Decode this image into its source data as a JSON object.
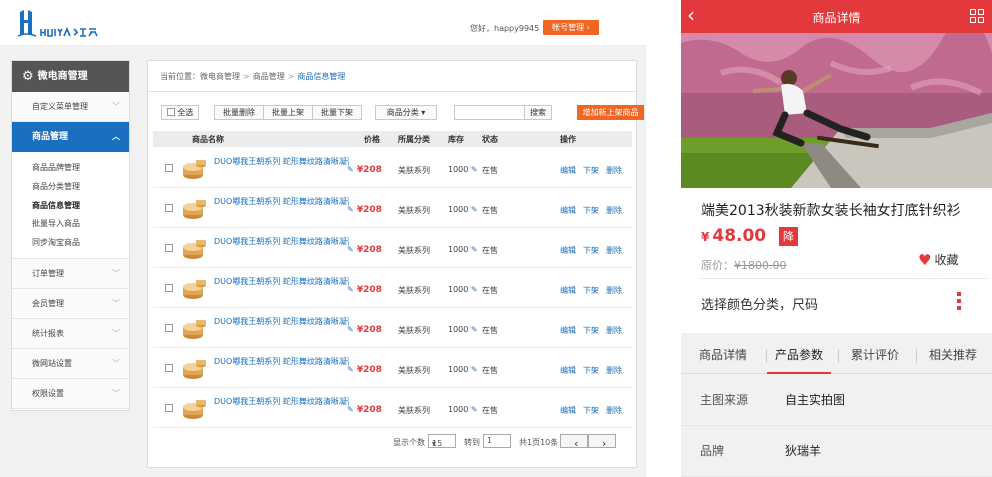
{
  "header": {
    "greeting": "您好，happy9945",
    "account_button": "帐号管理"
  },
  "colors": {
    "brand_blue": "#1a6fc1",
    "accent_orange": "#f26522",
    "mobile_red": "#e4393c"
  },
  "sidebar": {
    "title": "微电商管理",
    "top_items": [
      "自定义菜单管理"
    ],
    "active": "商品管理",
    "sub_items": [
      "商品品牌管理",
      "商品分类管理",
      "商品信息管理",
      "批量导入商品",
      "同步淘宝商品"
    ],
    "bottom_items": [
      "订单管理",
      "会员管理",
      "统计报表",
      "微网站设置",
      "权限设置"
    ]
  },
  "breadcrumb": {
    "prefix": "当前位置：微电商管理",
    "mid": "商品管理",
    "current": "商品信息管理"
  },
  "toolbar": {
    "select_all": "全选",
    "batch_delete": "批量删除",
    "batch_up": "批量上架",
    "batch_down": "批量下架",
    "category": "商品分类",
    "search": "搜索",
    "add": "增加新上架商品"
  },
  "table": {
    "headers": {
      "name": "商品名称",
      "price": "价格",
      "category": "所属分类",
      "stock": "库存",
      "status": "状态",
      "ops": "操作"
    },
    "rows": [
      {
        "name": "DUO嘟我王朝系列 蛇形舞纹路清晰凝膏",
        "price": "¥208",
        "category": "美肤系列",
        "stock": "1000",
        "status": "在售"
      },
      {
        "name": "DUO嘟我王朝系列 蛇形舞纹路清晰凝膏",
        "price": "¥208",
        "category": "美肤系列",
        "stock": "1000",
        "status": "在售"
      },
      {
        "name": "DUO嘟我王朝系列 蛇形舞纹路清晰凝膏",
        "price": "¥208",
        "category": "美肤系列",
        "stock": "1000",
        "status": "在售"
      },
      {
        "name": "DUO嘟我王朝系列 蛇形舞纹路清晰凝膏",
        "price": "¥208",
        "category": "美肤系列",
        "stock": "1000",
        "status": "在售"
      },
      {
        "name": "DUO嘟我王朝系列 蛇形舞纹路清晰凝膏",
        "price": "¥208",
        "category": "美肤系列",
        "stock": "1000",
        "status": "在售"
      },
      {
        "name": "DUO嘟我王朝系列 蛇形舞纹路清晰凝膏",
        "price": "¥208",
        "category": "美肤系列",
        "stock": "1000",
        "status": "在售"
      },
      {
        "name": "DUO嘟我王朝系列 蛇形舞纹路清晰凝膏",
        "price": "¥208",
        "category": "美肤系列",
        "stock": "1000",
        "status": "在售"
      }
    ],
    "op_edit": "编辑",
    "op_down": "下架",
    "op_delete": "删除"
  },
  "pager": {
    "show_label": "显示个数",
    "page_size": "15",
    "goto_label": "转到",
    "goto_value": "1",
    "total": "共1页10条"
  },
  "mobile": {
    "title": "商品详情",
    "product_name": "端美2013秋装新款女装长袖女打底针织衫",
    "price": "48.00",
    "currency": "¥",
    "drop_badge": "降",
    "orig_label": "原价：",
    "orig_price": "¥1800.00",
    "favorite": "收藏",
    "option_prompt": "选择颜色分类，尺码",
    "tabs": [
      "商品详情",
      "产品参数",
      "累计评价",
      "相关推荐"
    ],
    "active_tab": 1,
    "params": [
      {
        "key": "主图来源",
        "value": "自主实拍图"
      },
      {
        "key": "品牌",
        "value": "狄瑞羊"
      }
    ]
  }
}
